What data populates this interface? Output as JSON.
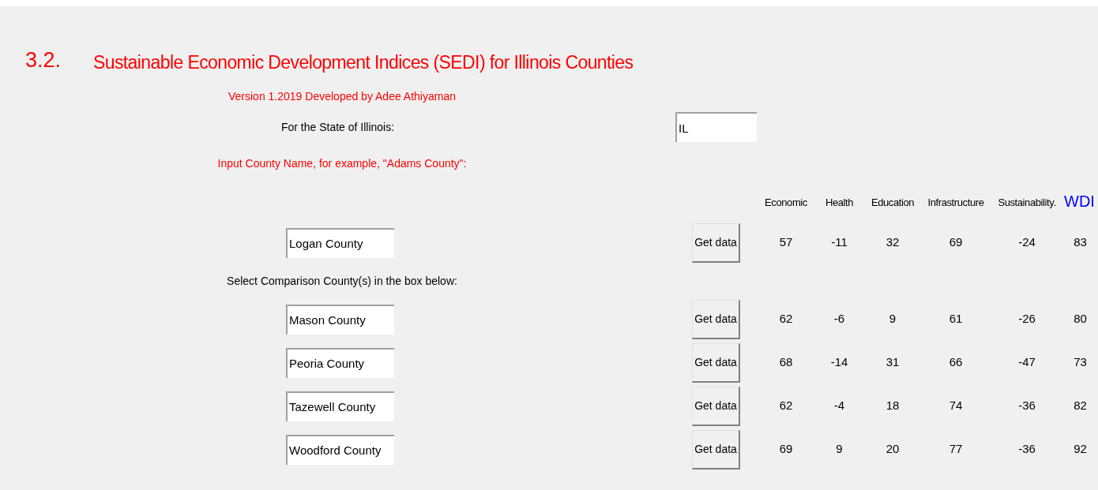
{
  "heading": {
    "number": "3.2.",
    "title": "Sustainable Economic Development Indices (SEDI) for Illinois Counties"
  },
  "version": "Version 1.2019 Developed by Adee Athiyaman",
  "state": {
    "label": "For the State of Illinois:",
    "value": "IL"
  },
  "county_prompt": "Input County Name, for example, \"Adams County\":",
  "columns": [
    {
      "label": "Economic",
      "kind": "score"
    },
    {
      "label": "Health",
      "kind": "score"
    },
    {
      "label": "Education",
      "kind": "score"
    },
    {
      "label": "Infrastructure",
      "kind": "score"
    },
    {
      "label": "Sustainability.",
      "kind": "score"
    },
    {
      "label": "WDI",
      "kind": "total"
    }
  ],
  "primary": {
    "county": "Logan County",
    "button": "Get data",
    "values": [
      "57",
      "-11",
      "32",
      "69",
      "-24",
      "83"
    ]
  },
  "comparison_prompt": "Select Comparison County(s) in the box below:",
  "comparisons": [
    {
      "county": "Mason County",
      "button": "Get data",
      "values": [
        "62",
        "-6",
        "9",
        "61",
        "-26",
        "80"
      ]
    },
    {
      "county": "Peoria County",
      "button": "Get data",
      "values": [
        "68",
        "-14",
        "31",
        "66",
        "-47",
        "73"
      ]
    },
    {
      "county": "Tazewell County",
      "button": "Get data",
      "values": [
        "62",
        "-4",
        "18",
        "74",
        "-36",
        "82"
      ]
    },
    {
      "county": "Woodford County",
      "button": "Get data",
      "values": [
        "69",
        "9",
        "20",
        "77",
        "-36",
        "92"
      ]
    }
  ]
}
